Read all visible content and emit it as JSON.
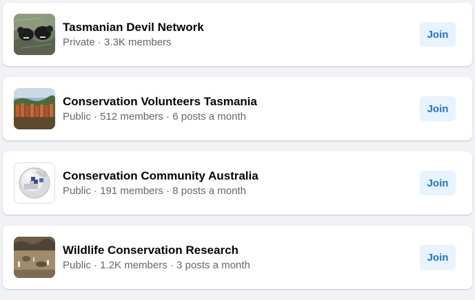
{
  "groups": [
    {
      "name": "Tasmanian Devil Network",
      "meta": "Private · 3.3K members",
      "join_label": "Join",
      "thumbnail": "tasmanian-devil-photo"
    },
    {
      "name": "Conservation Volunteers Tasmania",
      "meta": "Public · 512 members · 6 posts a month",
      "join_label": "Join",
      "thumbnail": "volunteers-group-photo"
    },
    {
      "name": "Conservation Community Australia",
      "meta": "Public · 191 members · 8 posts a month",
      "join_label": "Join",
      "thumbnail": "puzzle-globe-logo"
    },
    {
      "name": "Wildlife Conservation Research",
      "meta": "Public · 1.2K members · 3 posts a month",
      "join_label": "Join",
      "thumbnail": "wildlife-landscape-photo"
    }
  ],
  "colors": {
    "page_background": "#f0f2f5",
    "card_background": "#ffffff",
    "title_text": "#050505",
    "meta_text": "#65676b",
    "join_button_background": "#e7f3ff",
    "join_button_text": "#1b74e4"
  }
}
